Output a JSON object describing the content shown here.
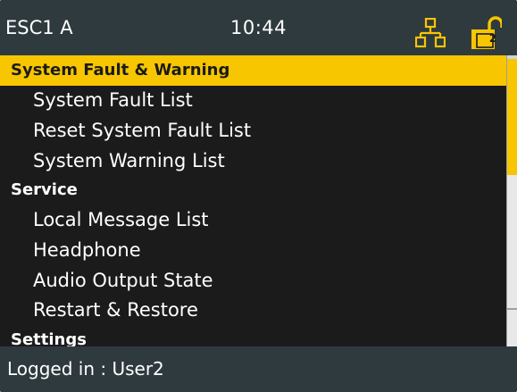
{
  "header": {
    "device_name": "ESC1 A",
    "time": "10:44",
    "network_icon": "network-icon",
    "lock_icon": "unlocked-padlock-icon",
    "user_level": "2",
    "accent_color": "#f7c600"
  },
  "menu": {
    "rows": [
      {
        "type": "section",
        "label": "System Fault & Warning",
        "selected": true
      },
      {
        "type": "item",
        "label": "System Fault List"
      },
      {
        "type": "item",
        "label": "Reset System Fault List"
      },
      {
        "type": "item",
        "label": "System Warning List"
      },
      {
        "type": "section",
        "label": "Service"
      },
      {
        "type": "item",
        "label": "Local Message List"
      },
      {
        "type": "item",
        "label": "Headphone"
      },
      {
        "type": "item",
        "label": "Audio Output State"
      },
      {
        "type": "item",
        "label": "Restart & Restore"
      },
      {
        "type": "section",
        "label": "Settings"
      }
    ]
  },
  "footer": {
    "status": "Logged in : User2"
  }
}
